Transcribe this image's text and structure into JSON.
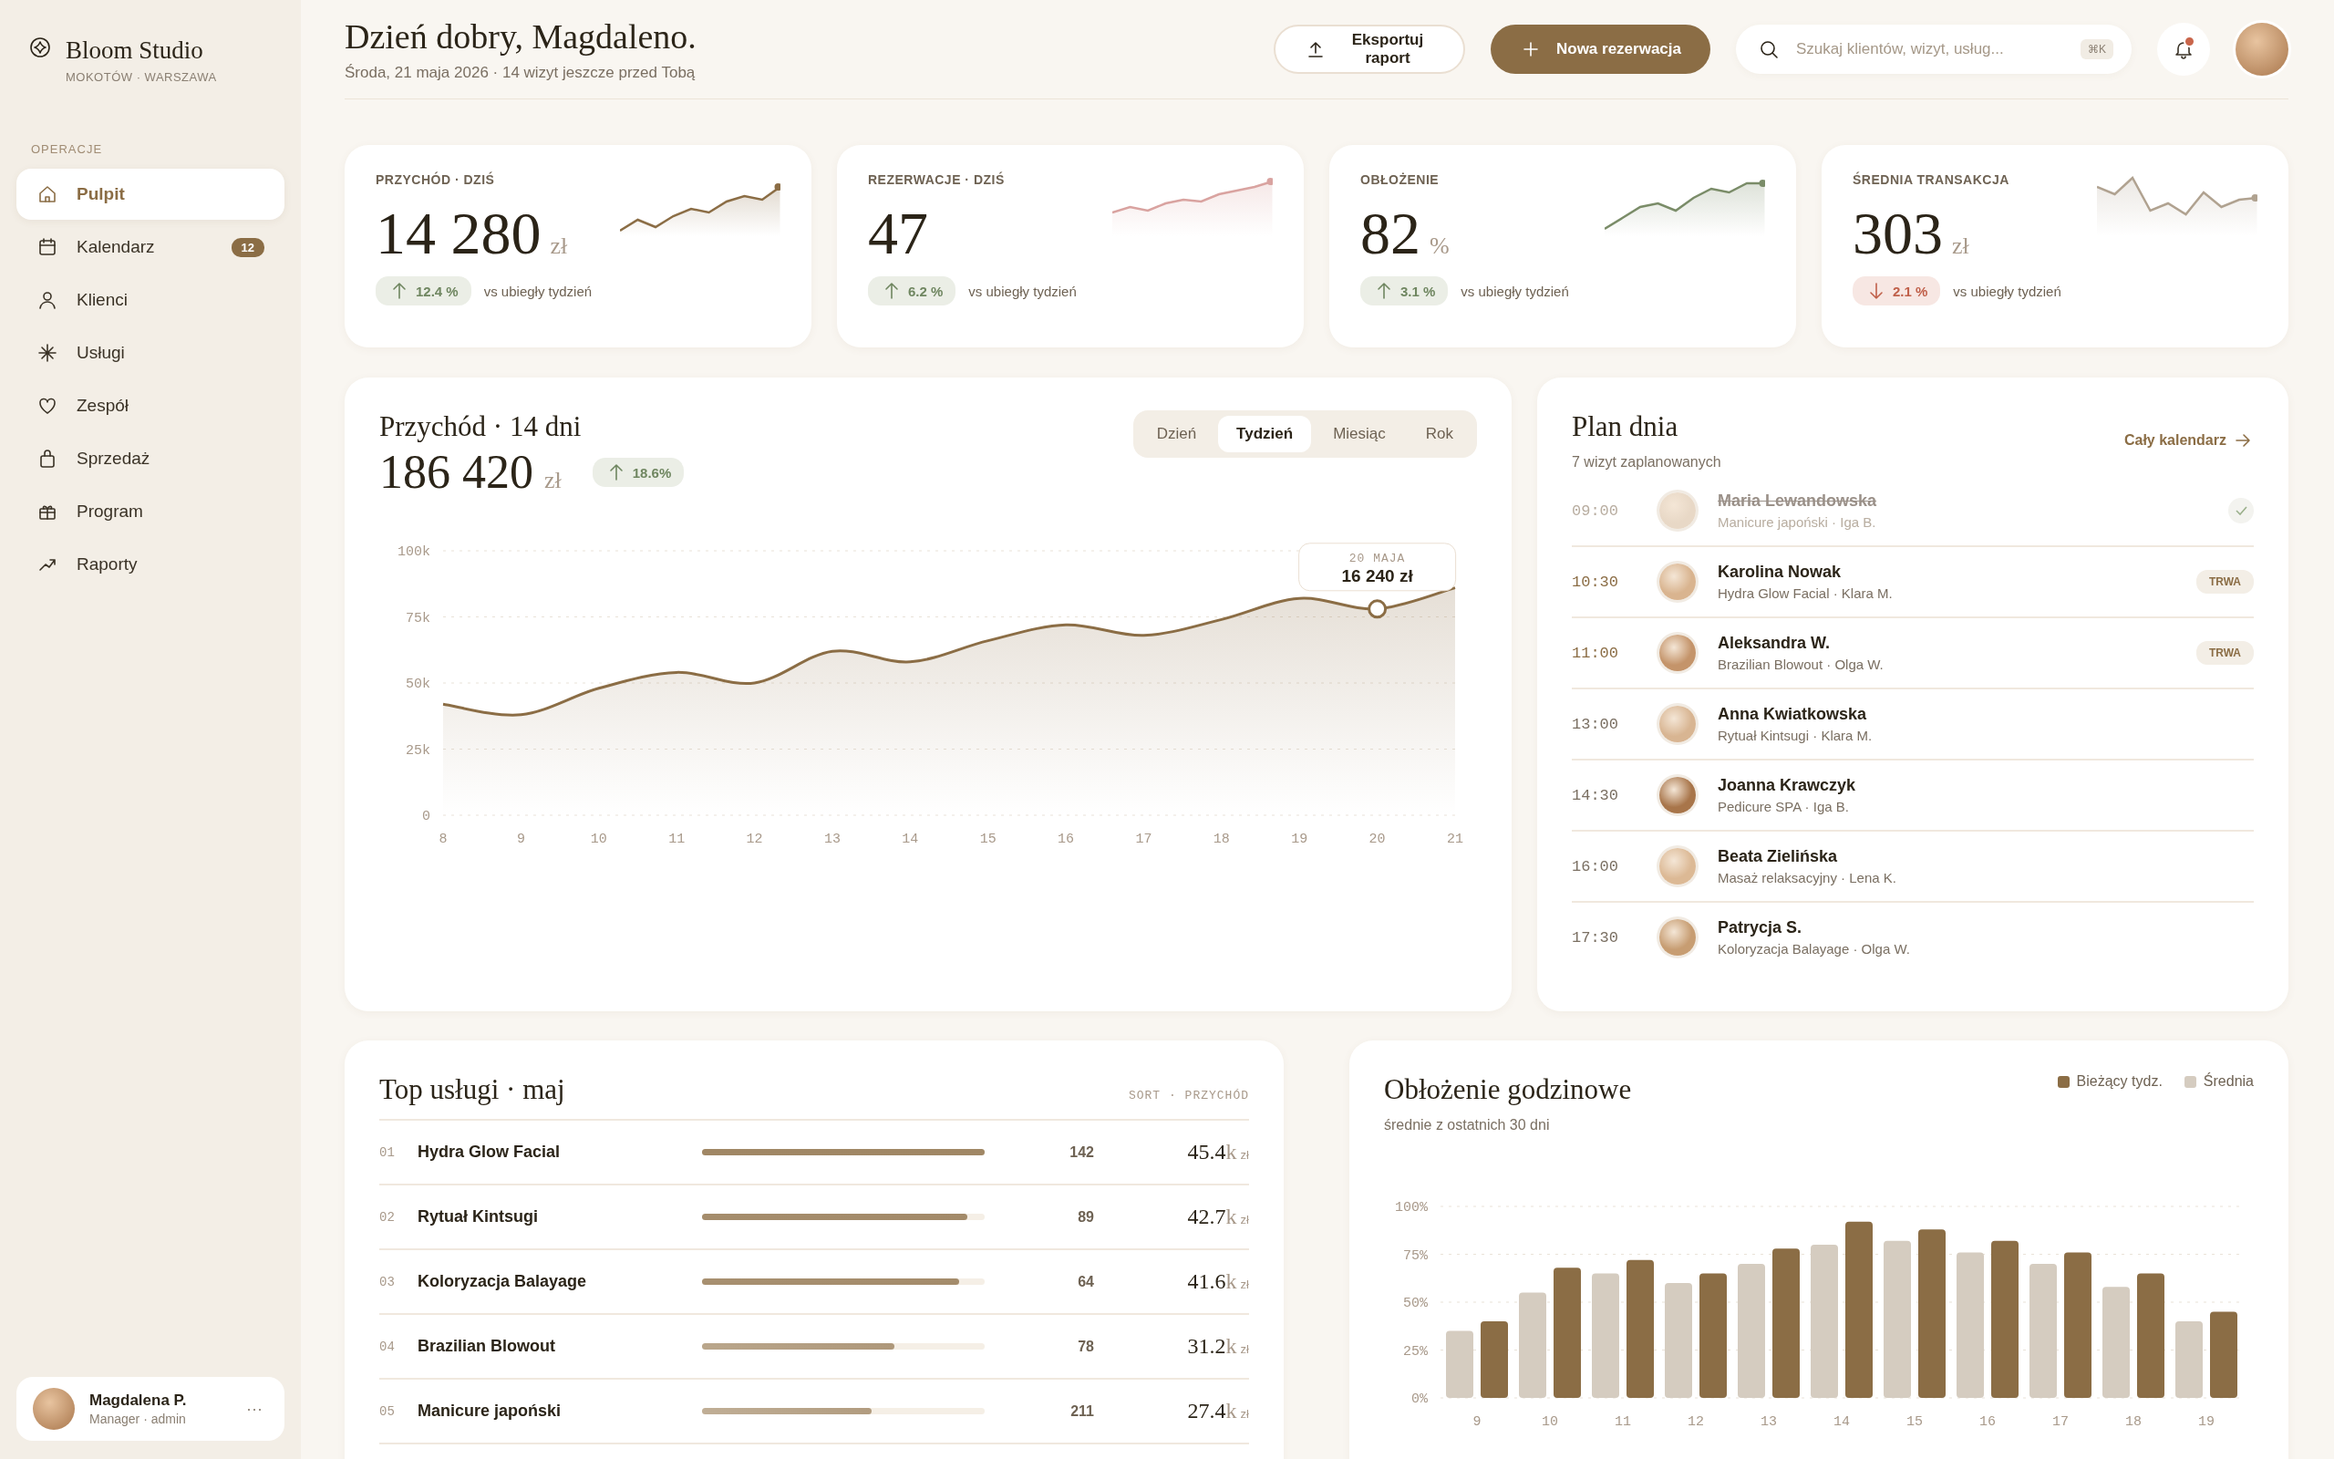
{
  "sidebar": {
    "brand": {
      "name": "Bloom Studio",
      "location": "MOKOTÓW · WARSZAWA"
    },
    "section": "OPERACJE",
    "items": [
      {
        "label": "Pulpit",
        "selected": true
      },
      {
        "label": "Kalendarz",
        "selected": false,
        "badge": "12"
      },
      {
        "label": "Klienci",
        "selected": false
      },
      {
        "label": "Usługi",
        "selected": false
      },
      {
        "label": "Zespół",
        "selected": false
      },
      {
        "label": "Sprzedaż",
        "selected": false
      },
      {
        "label": "Program",
        "selected": false
      },
      {
        "label": "Raporty",
        "selected": false
      }
    ],
    "user": {
      "name": "Magdalena P.",
      "role": "Manager · admin",
      "menu": "···"
    }
  },
  "header": {
    "greeting": "Dzień dobry, Magdaleno.",
    "subtitle": "Środa, 21 maja 2026 · 14 wizyt jeszcze przed Tobą",
    "export_button": "Eksportuj raport",
    "new_button": "Nowa rezerwacja",
    "search": {
      "placeholder": "Szukaj klientów, wizyt, usług...",
      "shortcut": "⌘K"
    },
    "notification": true
  },
  "kpis": [
    {
      "label": "PRZYCHÓD · DZIŚ",
      "value": "14 280",
      "unit": "zł",
      "delta": "12.4 %",
      "rising": true,
      "note": "vs ubiegły tydzień",
      "color": "#8b6d45"
    },
    {
      "label": "REZERWACJE · DZIŚ",
      "value": "47",
      "delta": "6.2 %",
      "rising": true,
      "note": "vs ubiegły tydzień",
      "color": "#d9a3a0"
    },
    {
      "label": "OBŁOŻENIE",
      "value": "82",
      "unit": "%",
      "delta": "3.1 %",
      "rising": true,
      "note": "vs ubiegły tydzień",
      "color": "#7a8c68"
    },
    {
      "label": "ŚREDNIA TRANSAKCJA",
      "value": "303",
      "unit": "zł",
      "delta": "2.1 %",
      "rising": false,
      "note": "vs ubiegły tydzień",
      "color": "#b0a290"
    }
  ],
  "revenue": {
    "title": "Przychód · 14 dni",
    "total": "186 420",
    "unit": "zł",
    "delta": "18.6%",
    "tabs": [
      {
        "label": "Dzień",
        "selected": false
      },
      {
        "label": "Tydzień",
        "selected": true
      },
      {
        "label": "Miesiąc",
        "selected": false
      },
      {
        "label": "Rok",
        "selected": false
      }
    ],
    "chart_data": {
      "type": "area",
      "categories": [
        "8",
        "9",
        "10",
        "11",
        "12",
        "13",
        "14",
        "15",
        "16",
        "17",
        "18",
        "19",
        "20",
        "21"
      ],
      "series": [
        {
          "color": "#8b6d45",
          "values": [
            42,
            38,
            48,
            54,
            50,
            62,
            58,
            66,
            72,
            68,
            74,
            82,
            78,
            86
          ]
        }
      ],
      "ylim": [
        0,
        100
      ],
      "grid": true,
      "yticks": [
        {
          "value": 0,
          "label": "0"
        },
        {
          "value": 25,
          "label": "25k"
        },
        {
          "value": 50,
          "label": "50k"
        },
        {
          "value": 75,
          "label": "75k"
        },
        {
          "value": 100,
          "label": "100k"
        }
      ]
    },
    "tooltip": {
      "date": "20 MAJA",
      "value": "16 240 zł"
    }
  },
  "plan": {
    "title": "Plan dnia",
    "subtitle": "7 wizyt zaplanowanych",
    "link": "Cały kalendarz",
    "appointments": [
      {
        "time": "09:00",
        "name": "Maria Lewandowska",
        "service": "Manicure japoński · Iga B.",
        "done": true,
        "ongoing": false,
        "color": "#e8d8c6"
      },
      {
        "time": "10:30",
        "name": "Karolina Nowak",
        "service": "Hydra Glow Facial · Klara M.",
        "done": false,
        "ongoing": true,
        "badge": "TRWA",
        "color": "#d9b48f"
      },
      {
        "time": "11:00",
        "name": "Aleksandra W.",
        "service": "Brazilian Blowout · Olga W.",
        "done": false,
        "ongoing": true,
        "badge": "TRWA",
        "color": "#c4946a"
      },
      {
        "time": "13:00",
        "name": "Anna Kwiatkowska",
        "service": "Rytuał Kintsugi · Klara M.",
        "done": false,
        "ongoing": false,
        "color": "#d8b592"
      },
      {
        "time": "14:30",
        "name": "Joanna Krawczyk",
        "service": "Pedicure SPA · Iga B.",
        "done": false,
        "ongoing": false,
        "color": "#a8754a"
      },
      {
        "time": "16:00",
        "name": "Beata Zielińska",
        "service": "Masaż relaksacyjny · Lena K.",
        "done": false,
        "ongoing": false,
        "color": "#dcb995"
      },
      {
        "time": "17:30",
        "name": "Patrycja S.",
        "service": "Koloryzacja Balayage · Olga W.",
        "done": false,
        "ongoing": false,
        "color": "#c79d72"
      }
    ]
  },
  "top_services": {
    "title": "Top usługi · maj",
    "sort": "SORT · PRZYCHÓD",
    "rows": [
      {
        "rank": "01",
        "name": "Hydra Glow Facial",
        "level": 1.0,
        "count": "142",
        "amount": "45.4",
        "suffix": "k",
        "currency": "zł"
      },
      {
        "rank": "02",
        "name": "Rytuał Kintsugi",
        "level": 0.94,
        "count": "89",
        "amount": "42.7",
        "suffix": "k",
        "currency": "zł"
      },
      {
        "rank": "03",
        "name": "Koloryzacja Balayage",
        "level": 0.91,
        "count": "64",
        "amount": "41.6",
        "suffix": "k",
        "currency": "zł"
      },
      {
        "rank": "04",
        "name": "Brazilian Blowout",
        "level": 0.68,
        "count": "78",
        "amount": "31.2",
        "suffix": "k",
        "currency": "zł"
      },
      {
        "rank": "05",
        "name": "Manicure japoński",
        "level": 0.6,
        "count": "211",
        "amount": "27.4",
        "suffix": "k",
        "currency": "zł"
      }
    ]
  },
  "occupancy": {
    "title": "Obłożenie godzinowe",
    "subtitle": "średnie z ostatnich 30 dni",
    "chart_data": {
      "type": "bar",
      "categories": [
        "9",
        "10",
        "11",
        "12",
        "13",
        "14",
        "15",
        "16",
        "17",
        "18",
        "19"
      ],
      "series": [
        {
          "name": "Średnia",
          "color": "#d5ccc0",
          "values": [
            35,
            55,
            65,
            60,
            70,
            80,
            82,
            76,
            70,
            58,
            40
          ]
        },
        {
          "name": "Bieżący tydz.",
          "color": "#8b6d45",
          "values": [
            40,
            68,
            72,
            65,
            78,
            92,
            88,
            82,
            76,
            65,
            45
          ]
        }
      ],
      "ylim": [
        0,
        100
      ],
      "grid": true,
      "yticks": [
        {
          "value": 0,
          "label": "0%"
        },
        {
          "value": 25,
          "label": "25%"
        },
        {
          "value": 50,
          "label": "50%"
        },
        {
          "value": 75,
          "label": "75%"
        },
        {
          "value": 100,
          "label": "100%"
        }
      ]
    }
  }
}
